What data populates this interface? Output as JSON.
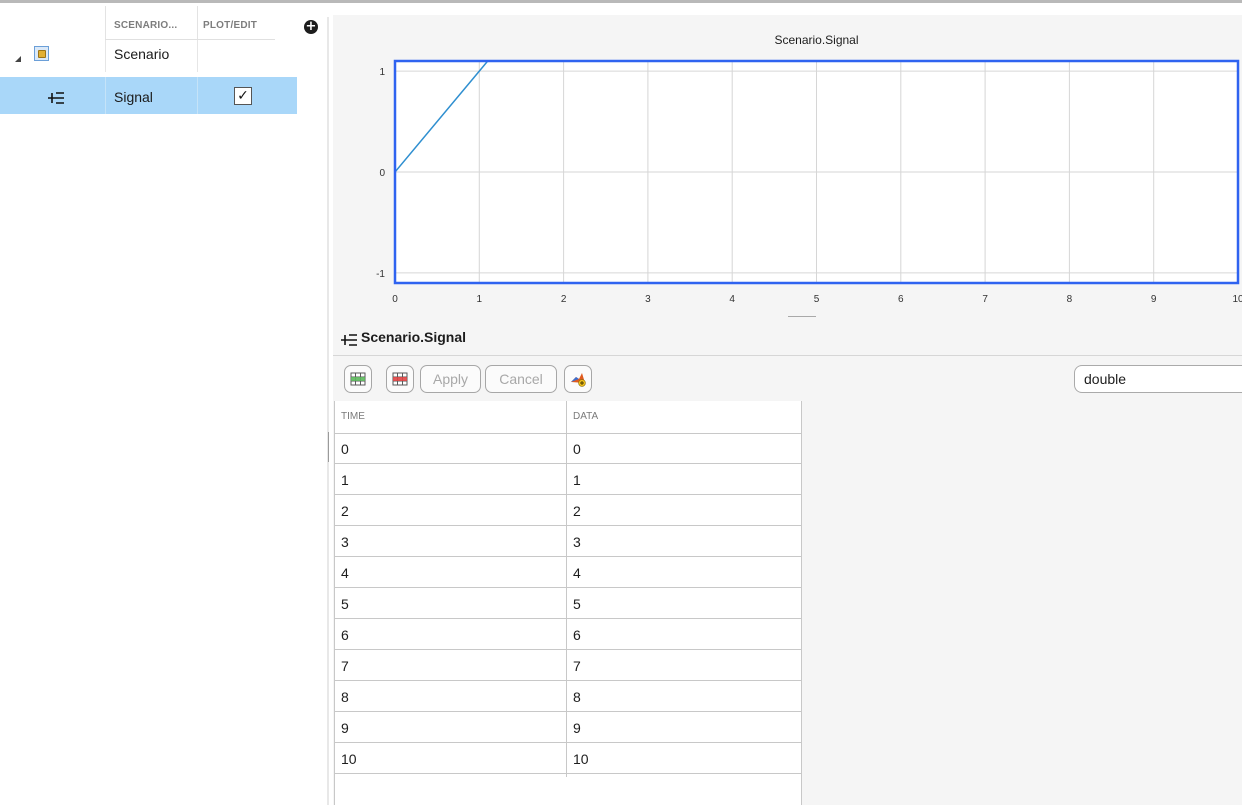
{
  "tree": {
    "columns": {
      "scenario": "SCENARIO...",
      "plot_edit": "PLOT/EDIT"
    },
    "rows": [
      {
        "name": "Scenario",
        "icon": "scenario-cube-icon",
        "expanded": true
      },
      {
        "name": "Signal",
        "icon": "signal-icon",
        "plot_checked": true,
        "selected": true
      }
    ],
    "add_button_icon": "plus-circle-icon",
    "checkmark": "✓"
  },
  "chart": {
    "title": "Scenario.Signal"
  },
  "chart_data": {
    "type": "line",
    "title": "Scenario.Signal",
    "xlabel": "",
    "ylabel": "",
    "xlim": [
      0,
      10
    ],
    "ylim": [
      -1.1,
      1.1
    ],
    "x_ticks": [
      "0",
      "1",
      "2",
      "3",
      "4",
      "5",
      "6",
      "7",
      "8",
      "9",
      "10"
    ],
    "y_ticks": [
      "1",
      "0",
      "-1"
    ],
    "grid": true,
    "series": [
      {
        "x": [
          0,
          1,
          2,
          3,
          4,
          5,
          6,
          7,
          8,
          9,
          10
        ],
        "y": [
          0,
          1,
          2,
          3,
          4,
          5,
          6,
          7,
          8,
          9,
          10
        ],
        "color": "#2f8fd0"
      }
    ],
    "frame_color": "#2f63f0"
  },
  "signal": {
    "title": "Scenario.Signal",
    "icon": "signal-icon",
    "toolbar": {
      "insert_row_icon": "insert-row-icon",
      "delete_row_icon": "delete-row-icon",
      "apply_label": "Apply",
      "cancel_label": "Cancel",
      "matlab_icon": "matlab-add-icon"
    },
    "data_type": "double"
  },
  "table": {
    "headers": [
      "TIME",
      "DATA"
    ],
    "rows": [
      [
        "0",
        "0"
      ],
      [
        "1",
        "1"
      ],
      [
        "2",
        "2"
      ],
      [
        "3",
        "3"
      ],
      [
        "4",
        "4"
      ],
      [
        "5",
        "5"
      ],
      [
        "6",
        "6"
      ],
      [
        "7",
        "7"
      ],
      [
        "8",
        "8"
      ],
      [
        "9",
        "9"
      ],
      [
        "10",
        "10"
      ]
    ]
  }
}
